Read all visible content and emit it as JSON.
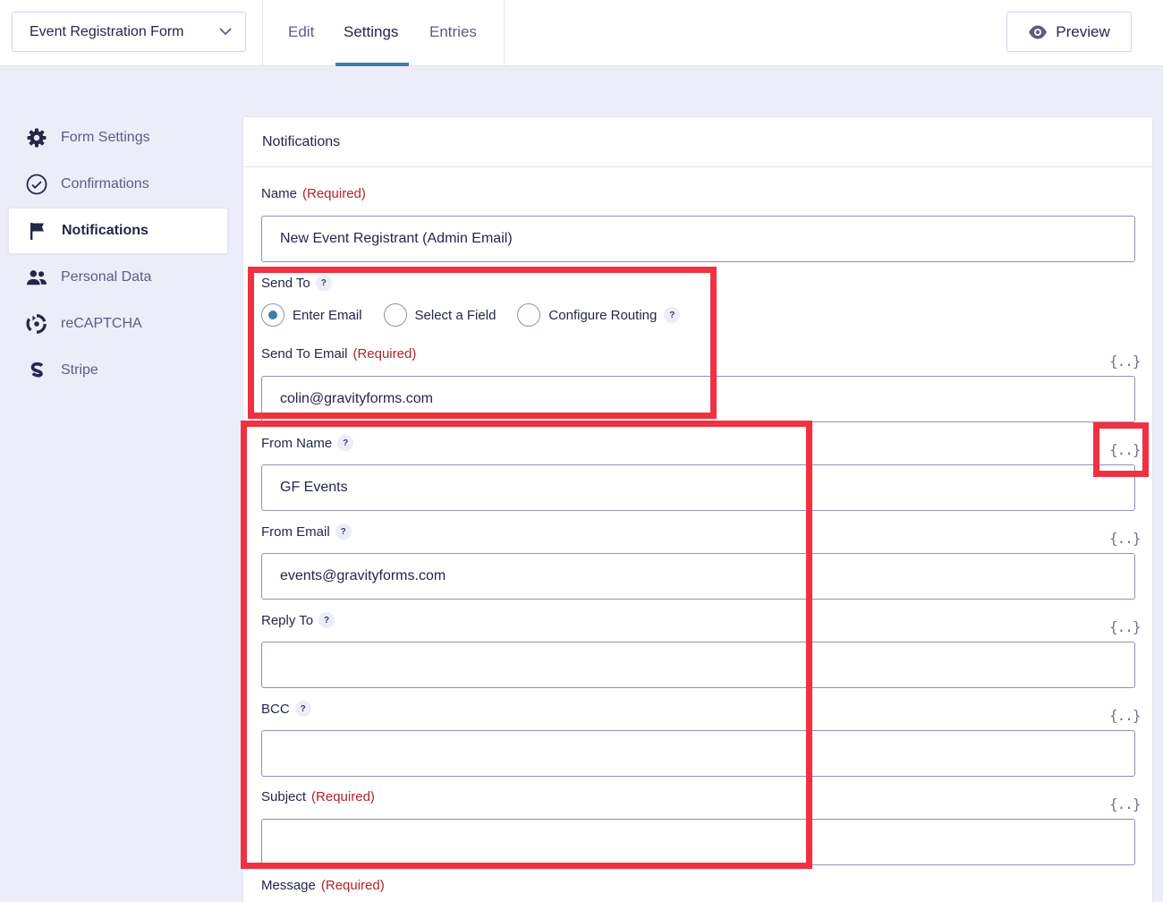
{
  "header": {
    "form_select": "Event Registration Form",
    "tabs": [
      "Edit",
      "Settings",
      "Entries"
    ],
    "active_tab": "Settings",
    "preview_label": "Preview"
  },
  "sidebar": {
    "items": [
      {
        "label": "Form Settings",
        "icon": "gear-icon"
      },
      {
        "label": "Confirmations",
        "icon": "check-circle-icon"
      },
      {
        "label": "Notifications",
        "icon": "flag-icon"
      },
      {
        "label": "Personal Data",
        "icon": "people-icon"
      },
      {
        "label": "reCAPTCHA",
        "icon": "recaptcha-icon"
      },
      {
        "label": "Stripe",
        "icon": "stripe-icon"
      }
    ],
    "active": "Notifications"
  },
  "panel": {
    "title": "Notifications",
    "required_text": "(Required)",
    "merge_tag_glyph": "{..}",
    "help_glyph": "?",
    "fields": {
      "name": {
        "label": "Name",
        "value": "New Event Registrant (Admin Email)"
      },
      "send_to": {
        "label": "Send To",
        "options": [
          "Enter Email",
          "Select a Field",
          "Configure Routing"
        ],
        "selected": "Enter Email"
      },
      "send_to_email": {
        "label": "Send To Email",
        "value": "colin@gravityforms.com"
      },
      "from_name": {
        "label": "From Name",
        "value": "GF Events"
      },
      "from_email": {
        "label": "From Email",
        "value": "events@gravityforms.com"
      },
      "reply_to": {
        "label": "Reply To",
        "value": ""
      },
      "bcc": {
        "label": "BCC",
        "value": ""
      },
      "subject": {
        "label": "Subject",
        "value": ""
      },
      "message": {
        "label": "Message"
      }
    }
  },
  "colors": {
    "accent": "#3e7da6",
    "highlight": "#f13140",
    "required": "#b0242c"
  }
}
